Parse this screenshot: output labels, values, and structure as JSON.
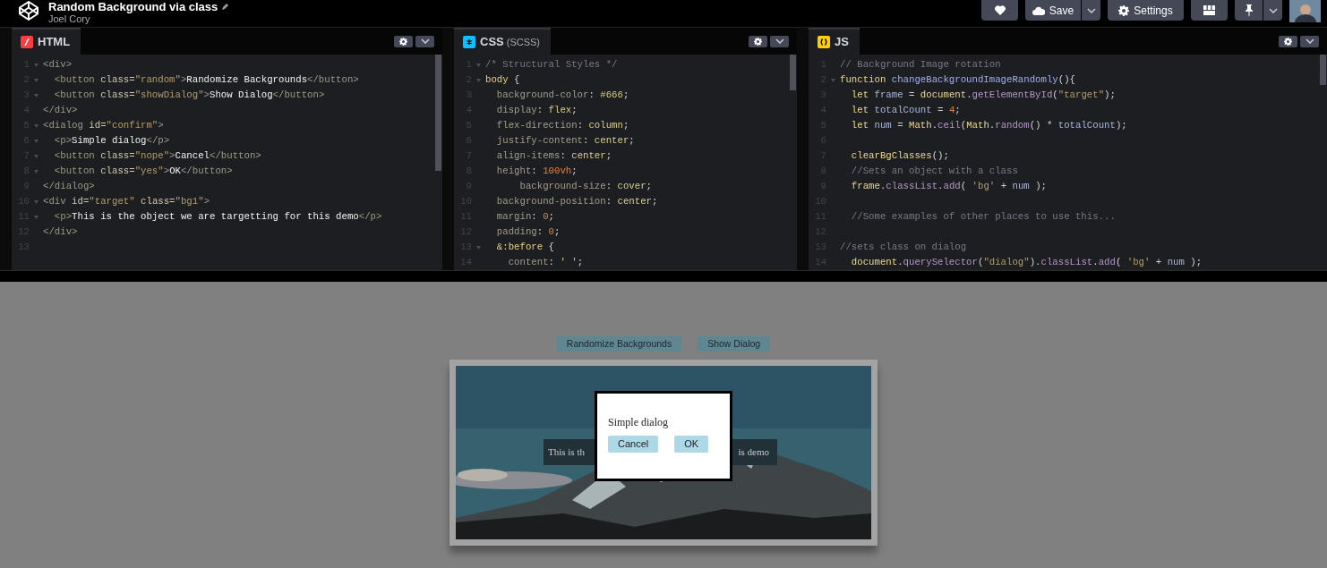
{
  "header": {
    "title": "Random Background via class",
    "author": "Joel Cory",
    "buttons": [
      {
        "kind": "heart"
      },
      {
        "kind": "save",
        "label": "Save"
      },
      {
        "kind": "settings",
        "label": "Settings"
      },
      {
        "kind": "layout"
      },
      {
        "kind": "pin"
      }
    ]
  },
  "editors": [
    {
      "kind": "html",
      "name": "HTML",
      "lines": [
        {
          "number": "1",
          "fold": true,
          "tokens": [
            {
              "kind": "tag",
              "text": "<div>"
            }
          ]
        },
        {
          "number": "2",
          "fold": true,
          "tokens": [
            {
              "kind": "tag",
              "text": "  <button "
            },
            {
              "kind": "attr",
              "text": "class="
            },
            {
              "kind": "string",
              "text": "\"random\""
            },
            {
              "kind": "tag",
              "text": ">"
            },
            {
              "kind": "text",
              "text": "Randomize Backgrounds"
            },
            {
              "kind": "tag",
              "text": "</button>"
            }
          ]
        },
        {
          "number": "3",
          "fold": true,
          "tokens": [
            {
              "kind": "tag",
              "text": "  <button "
            },
            {
              "kind": "attr",
              "text": "class="
            },
            {
              "kind": "string",
              "text": "\"showDialog\""
            },
            {
              "kind": "tag",
              "text": ">"
            },
            {
              "kind": "text",
              "text": "Show Dialog"
            },
            {
              "kind": "tag",
              "text": "</button>"
            }
          ]
        },
        {
          "number": "4",
          "fold": false,
          "tokens": [
            {
              "kind": "tag",
              "text": "</div>"
            }
          ]
        },
        {
          "number": "5",
          "fold": true,
          "tokens": [
            {
              "kind": "tag",
              "text": "<dialog "
            },
            {
              "kind": "attr",
              "text": "id="
            },
            {
              "kind": "string",
              "text": "\"confirm\""
            },
            {
              "kind": "tag",
              "text": ">"
            }
          ]
        },
        {
          "number": "6",
          "fold": true,
          "tokens": [
            {
              "kind": "tag",
              "text": "  <p>"
            },
            {
              "kind": "text",
              "text": "Simple dialog"
            },
            {
              "kind": "tag",
              "text": "</p>"
            }
          ]
        },
        {
          "number": "7",
          "fold": true,
          "tokens": [
            {
              "kind": "tag",
              "text": "  <button "
            },
            {
              "kind": "attr",
              "text": "class="
            },
            {
              "kind": "string",
              "text": "\"nope\""
            },
            {
              "kind": "tag",
              "text": ">"
            },
            {
              "kind": "text",
              "text": "Cancel"
            },
            {
              "kind": "tag",
              "text": "</button>"
            }
          ]
        },
        {
          "number": "8",
          "fold": true,
          "tokens": [
            {
              "kind": "tag",
              "text": "  <button "
            },
            {
              "kind": "attr",
              "text": "class="
            },
            {
              "kind": "string",
              "text": "\"yes\""
            },
            {
              "kind": "tag",
              "text": ">"
            },
            {
              "kind": "text",
              "text": "OK"
            },
            {
              "kind": "tag",
              "text": "</button>"
            }
          ]
        },
        {
          "number": "9",
          "fold": false,
          "tokens": [
            {
              "kind": "tag",
              "text": "</dialog>"
            }
          ]
        },
        {
          "number": "10",
          "fold": true,
          "tokens": [
            {
              "kind": "tag",
              "text": "<div "
            },
            {
              "kind": "attr",
              "text": "id="
            },
            {
              "kind": "string",
              "text": "\"target\""
            },
            {
              "kind": "attr",
              "text": " class="
            },
            {
              "kind": "string",
              "text": "\"bg1\""
            },
            {
              "kind": "tag",
              "text": ">"
            }
          ]
        },
        {
          "number": "11",
          "fold": true,
          "tokens": [
            {
              "kind": "tag",
              "text": "  <p>"
            },
            {
              "kind": "text",
              "text": "This is the object we are targetting for this demo"
            },
            {
              "kind": "tag",
              "text": "</p>"
            }
          ]
        },
        {
          "number": "12",
          "fold": false,
          "tokens": [
            {
              "kind": "tag",
              "text": "</div>"
            }
          ]
        },
        {
          "number": "13",
          "fold": false
        }
      ]
    },
    {
      "kind": "css",
      "name": "CSS",
      "suffix": "(SCSS)",
      "lines": [
        {
          "number": "1",
          "fold": true,
          "tokens": [
            {
              "kind": "comment",
              "text": "/* Structural Styles */"
            }
          ]
        },
        {
          "number": "2",
          "fold": true,
          "tokens": [
            {
              "kind": "selector",
              "text": "body"
            },
            {
              "kind": "punct",
              "text": " {"
            }
          ]
        },
        {
          "number": "3",
          "fold": false,
          "tokens": [
            {
              "kind": "property",
              "text": "  background-color"
            },
            {
              "kind": "punct",
              "text": ": "
            },
            {
              "kind": "value",
              "text": "#666"
            },
            {
              "kind": "punct",
              "text": ";"
            }
          ]
        },
        {
          "number": "4",
          "fold": false,
          "tokens": [
            {
              "kind": "property",
              "text": "  display"
            },
            {
              "kind": "punct",
              "text": ": "
            },
            {
              "kind": "value",
              "text": "flex"
            },
            {
              "kind": "punct",
              "text": ";"
            }
          ]
        },
        {
          "number": "5",
          "fold": false,
          "tokens": [
            {
              "kind": "property",
              "text": "  flex-direction"
            },
            {
              "kind": "punct",
              "text": ": "
            },
            {
              "kind": "value",
              "text": "column"
            },
            {
              "kind": "punct",
              "text": ";"
            }
          ]
        },
        {
          "number": "6",
          "fold": false,
          "tokens": [
            {
              "kind": "property",
              "text": "  justify-content"
            },
            {
              "kind": "punct",
              "text": ": "
            },
            {
              "kind": "value",
              "text": "center"
            },
            {
              "kind": "punct",
              "text": ";"
            }
          ]
        },
        {
          "number": "7",
          "fold": false,
          "tokens": [
            {
              "kind": "property",
              "text": "  align-items"
            },
            {
              "kind": "punct",
              "text": ": "
            },
            {
              "kind": "value",
              "text": "center"
            },
            {
              "kind": "punct",
              "text": ";"
            }
          ]
        },
        {
          "number": "8",
          "fold": false,
          "tokens": [
            {
              "kind": "property",
              "text": "  height"
            },
            {
              "kind": "punct",
              "text": ": "
            },
            {
              "kind": "number",
              "text": "100vh"
            },
            {
              "kind": "punct",
              "text": ";"
            }
          ]
        },
        {
          "number": "9",
          "fold": false,
          "tokens": [
            {
              "kind": "property",
              "text": "      background-size"
            },
            {
              "kind": "punct",
              "text": ": "
            },
            {
              "kind": "value",
              "text": "cover"
            },
            {
              "kind": "punct",
              "text": ";"
            }
          ]
        },
        {
          "number": "10",
          "fold": false,
          "tokens": [
            {
              "kind": "property",
              "text": "  background-position"
            },
            {
              "kind": "punct",
              "text": ": "
            },
            {
              "kind": "value",
              "text": "center"
            },
            {
              "kind": "punct",
              "text": ";"
            }
          ]
        },
        {
          "number": "11",
          "fold": false,
          "tokens": [
            {
              "kind": "property",
              "text": "  margin"
            },
            {
              "kind": "punct",
              "text": ": "
            },
            {
              "kind": "number",
              "text": "0"
            },
            {
              "kind": "punct",
              "text": ";"
            }
          ]
        },
        {
          "number": "12",
          "fold": false,
          "tokens": [
            {
              "kind": "property",
              "text": "  padding"
            },
            {
              "kind": "punct",
              "text": ": "
            },
            {
              "kind": "number",
              "text": "0"
            },
            {
              "kind": "punct",
              "text": ";"
            }
          ]
        },
        {
          "number": "13",
          "fold": true,
          "tokens": [
            {
              "kind": "selector",
              "text": "  &:before"
            },
            {
              "kind": "punct",
              "text": " {"
            }
          ]
        },
        {
          "number": "14",
          "fold": false,
          "tokens": [
            {
              "kind": "property",
              "text": "    content"
            },
            {
              "kind": "punct",
              "text": ": "
            },
            {
              "kind": "value",
              "text": "' '"
            },
            {
              "kind": "punct",
              "text": ";"
            }
          ]
        }
      ]
    },
    {
      "kind": "js",
      "name": "JS",
      "lines": [
        {
          "number": "1",
          "fold": false,
          "tokens": [
            {
              "kind": "comment",
              "text": "// Background Image rotation"
            }
          ]
        },
        {
          "number": "2",
          "fold": true,
          "tokens": [
            {
              "kind": "keyword",
              "text": "function "
            },
            {
              "kind": "function",
              "text": "changeBackgroundImageRandomly"
            },
            {
              "kind": "punct",
              "text": "(){"
            }
          ]
        },
        {
          "number": "3",
          "fold": false,
          "tokens": [
            {
              "kind": "keyword",
              "text": "  let "
            },
            {
              "kind": "variable",
              "text": "frame"
            },
            {
              "kind": "punct",
              "text": " = "
            },
            {
              "kind": "object",
              "text": "document"
            },
            {
              "kind": "punct",
              "text": "."
            },
            {
              "kind": "method",
              "text": "getElementById"
            },
            {
              "kind": "punct",
              "text": "("
            },
            {
              "kind": "string",
              "text": "\"target\""
            },
            {
              "kind": "punct",
              "text": ");"
            }
          ]
        },
        {
          "number": "4",
          "fold": false,
          "tokens": [
            {
              "kind": "keyword",
              "text": "  let "
            },
            {
              "kind": "variable",
              "text": "totalCount"
            },
            {
              "kind": "punct",
              "text": " = "
            },
            {
              "kind": "number",
              "text": "4"
            },
            {
              "kind": "punct",
              "text": ";"
            }
          ]
        },
        {
          "number": "5",
          "fold": false,
          "tokens": [
            {
              "kind": "keyword",
              "text": "  let "
            },
            {
              "kind": "variable",
              "text": "num"
            },
            {
              "kind": "punct",
              "text": " = "
            },
            {
              "kind": "object",
              "text": "Math"
            },
            {
              "kind": "punct",
              "text": "."
            },
            {
              "kind": "method",
              "text": "ceil"
            },
            {
              "kind": "punct",
              "text": "("
            },
            {
              "kind": "object",
              "text": "Math"
            },
            {
              "kind": "punct",
              "text": "."
            },
            {
              "kind": "method",
              "text": "random"
            },
            {
              "kind": "punct",
              "text": "() * "
            },
            {
              "kind": "variable",
              "text": "totalCount"
            },
            {
              "kind": "punct",
              "text": ");"
            }
          ]
        },
        {
          "number": "6",
          "fold": false
        },
        {
          "number": "7",
          "fold": false,
          "tokens": [
            {
              "kind": "object",
              "text": "  clearBgClasses"
            },
            {
              "kind": "punct",
              "text": "();"
            }
          ]
        },
        {
          "number": "8",
          "fold": false,
          "tokens": [
            {
              "kind": "comment",
              "text": "  //Sets an object with a class"
            }
          ]
        },
        {
          "number": "9",
          "fold": false,
          "tokens": [
            {
              "kind": "object",
              "text": "  frame"
            },
            {
              "kind": "punct",
              "text": "."
            },
            {
              "kind": "method",
              "text": "classList"
            },
            {
              "kind": "punct",
              "text": "."
            },
            {
              "kind": "method",
              "text": "add"
            },
            {
              "kind": "punct",
              "text": "( "
            },
            {
              "kind": "string",
              "text": "'bg'"
            },
            {
              "kind": "punct",
              "text": " + "
            },
            {
              "kind": "variable",
              "text": "num"
            },
            {
              "kind": "punct",
              "text": " );"
            }
          ]
        },
        {
          "number": "10",
          "fold": false
        },
        {
          "number": "11",
          "fold": false,
          "tokens": [
            {
              "kind": "comment",
              "text": "  //Some examples of other places to use this..."
            }
          ]
        },
        {
          "number": "12",
          "fold": false
        },
        {
          "number": "13",
          "fold": false,
          "tokens": [
            {
              "kind": "comment",
              "text": "//sets class on dialog"
            }
          ]
        },
        {
          "number": "14",
          "fold": false,
          "tokens": [
            {
              "kind": "object",
              "text": "  document"
            },
            {
              "kind": "punct",
              "text": "."
            },
            {
              "kind": "method",
              "text": "querySelector"
            },
            {
              "kind": "punct",
              "text": "("
            },
            {
              "kind": "string",
              "text": "\"dialog\""
            },
            {
              "kind": "punct",
              "text": ")."
            },
            {
              "kind": "method",
              "text": "classList"
            },
            {
              "kind": "punct",
              "text": "."
            },
            {
              "kind": "method",
              "text": "add"
            },
            {
              "kind": "punct",
              "text": "( "
            },
            {
              "kind": "string",
              "text": "'bg'"
            },
            {
              "kind": "punct",
              "text": " + "
            },
            {
              "kind": "variable",
              "text": "num"
            },
            {
              "kind": "punct",
              "text": " );"
            }
          ]
        }
      ]
    }
  ],
  "preview": {
    "buttons": [
      "Randomize Backgrounds",
      "Show Dialog"
    ],
    "target_text": [
      "This is th",
      "is demo"
    ],
    "dialog": {
      "text": "Simple dialog",
      "buttons": [
        "Cancel",
        "OK"
      ]
    }
  }
}
